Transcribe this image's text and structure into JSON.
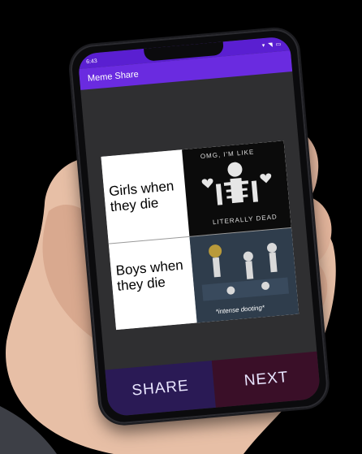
{
  "status": {
    "time": "6:43",
    "icons": "▾ ◥ ▭"
  },
  "appbar": {
    "title": "Meme Share"
  },
  "meme": {
    "top_text": "Girls when they die",
    "bottom_text": "Boys when they die",
    "top_image_caption_top": "OMG, I'M LIKE",
    "top_image_caption_bottom": "LITERALLY DEAD",
    "bottom_image_caption": "*intense dooting*"
  },
  "buttons": {
    "share": "SHARE",
    "next": "NEXT"
  },
  "colors": {
    "statusbar": "#5a1fd1",
    "appbar": "#6a2be0",
    "share_bg": "#2a1a55",
    "next_bg": "#3a0f28"
  }
}
